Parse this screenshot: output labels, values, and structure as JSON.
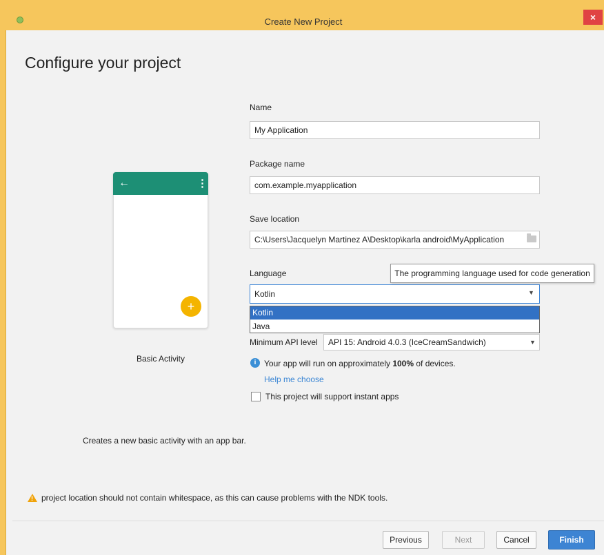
{
  "window": {
    "title": "Create New Project",
    "close_label": "×"
  },
  "heading": "Configure your project",
  "preview": {
    "activity_name": "Basic Activity",
    "description": "Creates a new basic activity with an app bar.",
    "back_icon": "←",
    "menu_icon": "⋮",
    "fab_icon": "+"
  },
  "form": {
    "name": {
      "label": "Name",
      "value": "My Application"
    },
    "package": {
      "label": "Package name",
      "value": "com.example.myapplication"
    },
    "save_location": {
      "label": "Save location",
      "value": "C:\\Users\\Jacquelyn Martinez A\\Desktop\\karla android\\MyApplication"
    },
    "language": {
      "label": "Language",
      "value": "Kotlin",
      "tooltip": "The programming language used for code generation",
      "options": [
        "Kotlin",
        "Java"
      ],
      "selected_index": 0
    },
    "min_api": {
      "label": "Minimum API level",
      "value": "API 15: Android 4.0.3 (IceCreamSandwich)"
    },
    "coverage": {
      "text_prefix": "Your app will run on approximately ",
      "percent": "100%",
      "text_suffix": " of devices.",
      "help_link": "Help me choose"
    },
    "instant_apps": {
      "label": "This project will support instant apps",
      "checked": false
    }
  },
  "warning": "project location should not contain whitespace, as this can cause problems with the NDK tools.",
  "buttons": {
    "previous": "Previous",
    "next": "Next",
    "cancel": "Cancel",
    "finish": "Finish"
  },
  "colors": {
    "accent": "#3d84d3",
    "app_bar": "#1d8f75",
    "fab": "#f4b400",
    "warning": "#f0a30a",
    "window_frame": "#f6c65c"
  }
}
